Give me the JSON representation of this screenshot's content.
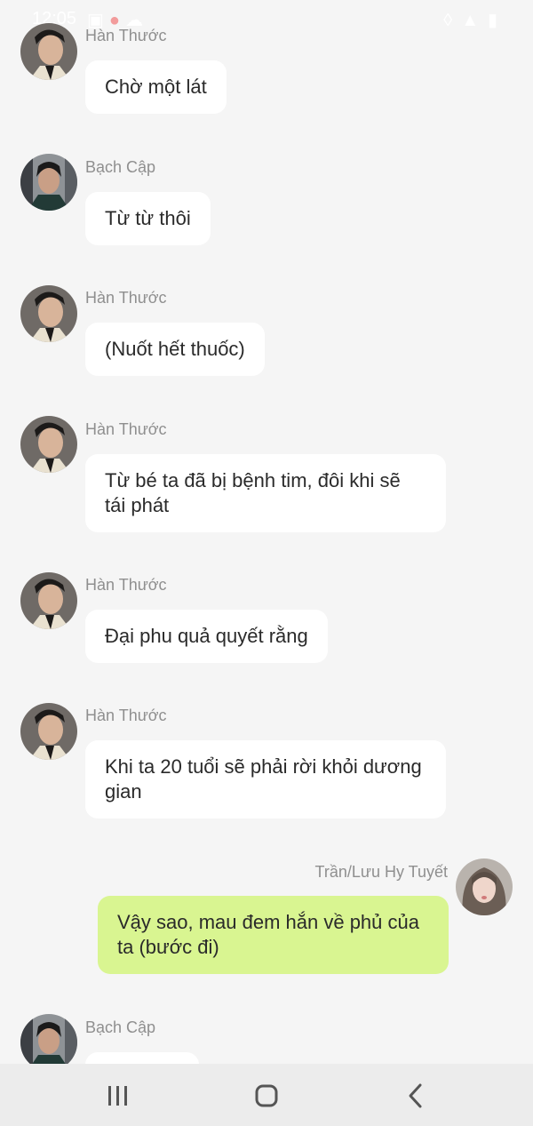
{
  "status_bar": {
    "time": "12:05",
    "left_icons": [
      "gallery-icon",
      "peach-icon",
      "cloud-icon"
    ],
    "right_icons": [
      "wifi-icon",
      "signal-icon",
      "battery-icon"
    ]
  },
  "messages": [
    {
      "sender": "Hàn Thước",
      "text": "Chờ một lát",
      "outgoing": false,
      "avatar": "han-thuoc"
    },
    {
      "sender": "Bạch Cập",
      "text": "Từ từ thôi",
      "outgoing": false,
      "avatar": "bach-cap"
    },
    {
      "sender": "Hàn Thước",
      "text": "(Nuốt hết thuốc)",
      "outgoing": false,
      "avatar": "han-thuoc"
    },
    {
      "sender": "Hàn Thước",
      "text": "Từ bé ta đã bị bệnh tim, đôi khi sẽ tái phát",
      "outgoing": false,
      "avatar": "han-thuoc"
    },
    {
      "sender": "Hàn Thước",
      "text": "Đại phu quả quyết rằng",
      "outgoing": false,
      "avatar": "han-thuoc"
    },
    {
      "sender": "Hàn Thước",
      "text": "Khi ta 20 tuổi sẽ phải rời khỏi dương gian",
      "outgoing": false,
      "avatar": "han-thuoc"
    },
    {
      "sender": "Trần/Lưu Hy Tuyết",
      "text": "Vậy sao, mau đem hắn về phủ của ta (bước đi)",
      "outgoing": true,
      "avatar": "hy-tuyet"
    },
    {
      "sender": "Bạch Cập",
      "text": "",
      "outgoing": false,
      "avatar": "bach-cap"
    }
  ],
  "colors": {
    "background": "#f5f5f5",
    "incoming_bubble": "#ffffff",
    "outgoing_bubble": "#d9f591",
    "sender_name": "#8f8f8f",
    "nav_bar": "#ececec"
  },
  "nav_bar": {
    "buttons": [
      "recent-apps-icon",
      "home-icon",
      "back-icon"
    ]
  }
}
